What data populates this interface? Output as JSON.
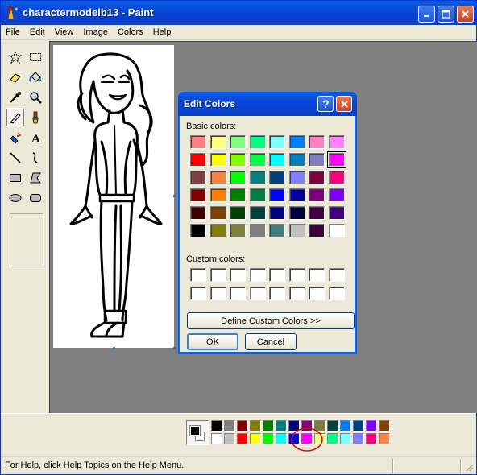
{
  "window": {
    "title": "charactermodelb13 - Paint",
    "minimize_icon": "minimize-icon",
    "maximize_icon": "maximize-icon",
    "close_icon": "close-icon"
  },
  "menu": [
    "File",
    "Edit",
    "View",
    "Image",
    "Colors",
    "Help"
  ],
  "tools": [
    {
      "name": "free-form-select",
      "icon": "star-select-icon"
    },
    {
      "name": "select",
      "icon": "rect-select-icon"
    },
    {
      "name": "eraser",
      "icon": "eraser-icon"
    },
    {
      "name": "fill-with-color",
      "icon": "paint-bucket-icon"
    },
    {
      "name": "pick-color",
      "icon": "eyedropper-icon"
    },
    {
      "name": "magnifier",
      "icon": "magnifier-icon"
    },
    {
      "name": "pencil",
      "icon": "pencil-icon"
    },
    {
      "name": "brush",
      "icon": "brush-icon"
    },
    {
      "name": "airbrush",
      "icon": "airbrush-icon"
    },
    {
      "name": "text",
      "icon": "text-icon"
    },
    {
      "name": "line",
      "icon": "line-icon"
    },
    {
      "name": "curve",
      "icon": "curve-icon"
    },
    {
      "name": "rectangle",
      "icon": "rectangle-icon"
    },
    {
      "name": "polygon",
      "icon": "polygon-icon"
    },
    {
      "name": "ellipse",
      "icon": "ellipse-icon"
    },
    {
      "name": "rounded-rectangle",
      "icon": "rounded-rectangle-icon"
    }
  ],
  "selected_tool": "pencil",
  "dialog": {
    "title": "Edit Colors",
    "help_icon": "help-icon",
    "close_icon": "close-icon",
    "basic_colors_label": "Basic colors:",
    "custom_colors_label": "Custom colors:",
    "define_button": "Define Custom Colors >>",
    "ok_button": "OK",
    "cancel_button": "Cancel",
    "selected_basic_color": "#ff00ff",
    "basic_colors": [
      [
        "#ff8080",
        "#ffff80",
        "#80ff80",
        "#00ff80",
        "#80ffff",
        "#0080ff",
        "#ff80c0",
        "#ff80ff"
      ],
      [
        "#ff0000",
        "#ffff00",
        "#80ff00",
        "#00ff40",
        "#00ffff",
        "#0080c0",
        "#8080c0",
        "#ff00ff"
      ],
      [
        "#804040",
        "#ff8040",
        "#00ff00",
        "#008080",
        "#004080",
        "#8080ff",
        "#800040",
        "#ff0080"
      ],
      [
        "#800000",
        "#ff8000",
        "#008000",
        "#008040",
        "#0000ff",
        "#0000a0",
        "#800080",
        "#8000ff"
      ],
      [
        "#400000",
        "#804000",
        "#004000",
        "#004040",
        "#000080",
        "#000040",
        "#400040",
        "#400080"
      ],
      [
        "#000000",
        "#808000",
        "#808040",
        "#808080",
        "#408080",
        "#c0c0c0",
        "#400040",
        "#ffffff"
      ]
    ]
  },
  "palette": {
    "foreground": "#000000",
    "background": "#ffffff",
    "highlighted_color": "#ff00ff",
    "top_row": [
      "#000000",
      "#808080",
      "#800000",
      "#808000",
      "#008000",
      "#008080",
      "#000080",
      "#800080",
      "#808040",
      "#004040",
      "#0080ff",
      "#004080",
      "#8000ff",
      "#804000"
    ],
    "bottom_row": [
      "#ffffff",
      "#c0c0c0",
      "#ff0000",
      "#ffff00",
      "#00ff00",
      "#00ffff",
      "#0000ff",
      "#ff00ff",
      "#ffff80",
      "#00ff80",
      "#80ffff",
      "#8080ff",
      "#ff0080",
      "#ff8040"
    ]
  },
  "status": {
    "text": "For Help, click Help Topics on the Help Menu."
  }
}
